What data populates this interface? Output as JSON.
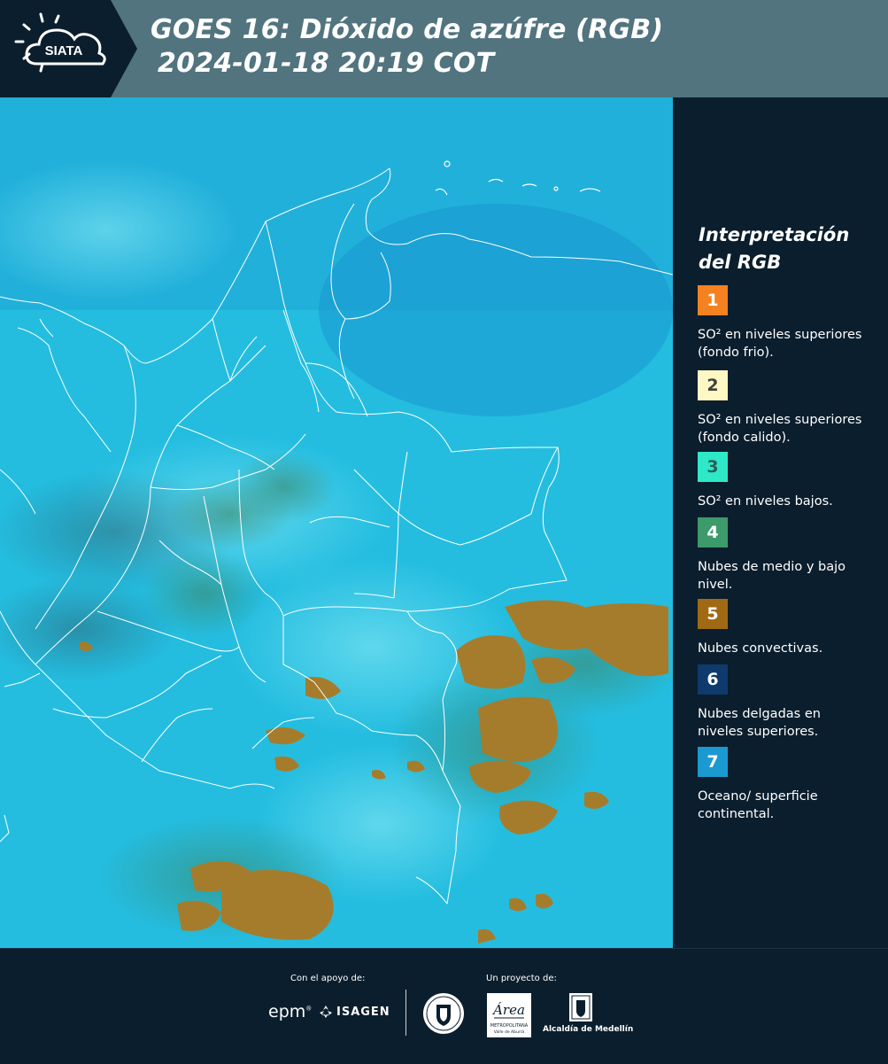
{
  "header": {
    "logo_text": "SIATA",
    "title_line1": "GOES 16: Dióxido de azúfre (RGB)",
    "title_line2": "2024-01-18 20:19 COT"
  },
  "legend": {
    "title_line1": "Interpretación",
    "title_line2": "del RGB",
    "items": [
      {
        "num": "1",
        "color": "#f58220",
        "text_color": "#ffffff",
        "desc": "SO² en niveles superiores (fondo frio)."
      },
      {
        "num": "2",
        "color": "#fff8c4",
        "text_color": "#404040",
        "desc": "SO² en niveles superiores (fondo calido)."
      },
      {
        "num": "3",
        "color": "#2ee8c8",
        "text_color": "#2b5f58",
        "desc": "SO² en niveles bajos."
      },
      {
        "num": "4",
        "color": "#3d9a6a",
        "text_color": "#ffffff",
        "desc": "Nubes de medio y bajo nivel."
      },
      {
        "num": "5",
        "color": "#a06a14",
        "text_color": "#ffffff",
        "desc": "Nubes convectivas."
      },
      {
        "num": "6",
        "color": "#0e3a6e",
        "text_color": "#ffffff",
        "desc": "Nubes delgadas en niveles superiores."
      },
      {
        "num": "7",
        "color": "#1a9ad0",
        "text_color": "#ffffff",
        "desc": "Oceano/ superficie continental."
      }
    ]
  },
  "footer": {
    "support_label": "Con el apoyo de:",
    "project_label": "Un proyecto de:",
    "epm": "epm",
    "isagen": "ISAGEN",
    "area_text": "Área",
    "area_sub": "METROPOLITANA",
    "area_sub2": "Valle de Aburrá",
    "alcaldia": "Alcaldía de Medellín"
  },
  "colors": {
    "header_bg": "#51747f",
    "panel_bg": "#0b1e2d",
    "ocean": "#22c6e8",
    "convective": "#a07a2a"
  }
}
